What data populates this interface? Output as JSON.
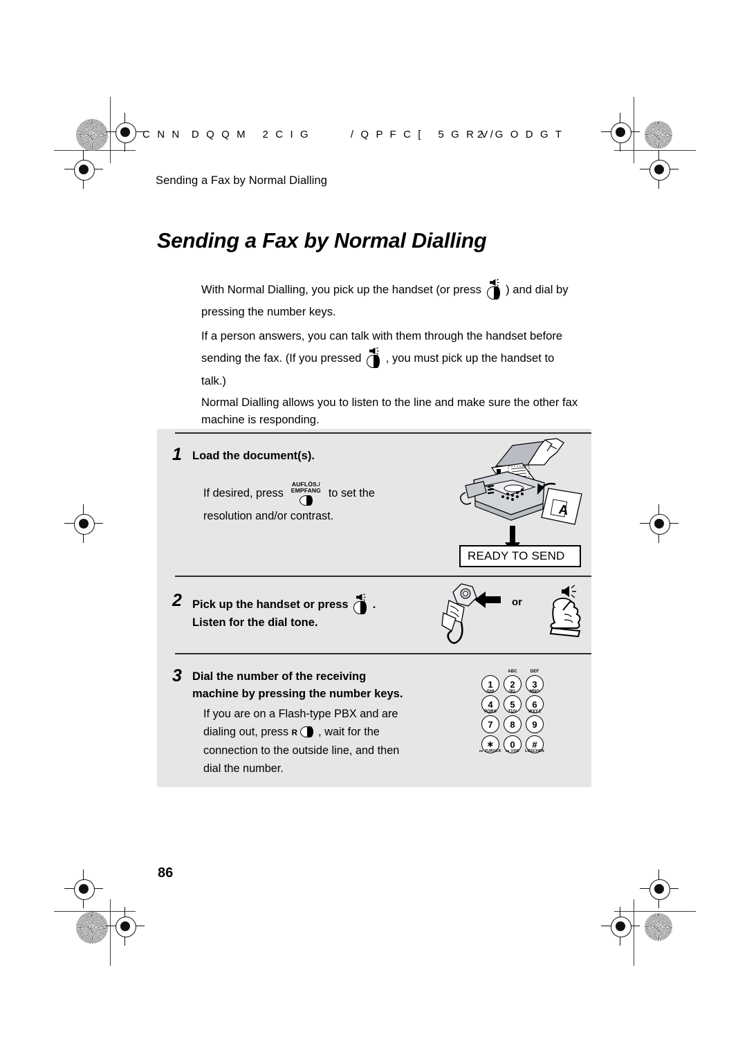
{
  "page": {
    "encoded_header": "C N N  D Q Q M   2 C I G        / Q P F C [   5 G R V G O D G T",
    "encoded_header_right": "2 /",
    "running_head": "Sending a Fax by Normal Dialling",
    "title": "Sending a Fax by Normal Dialling",
    "page_number": "86"
  },
  "intro": {
    "p1_a": "With Normal Dialling, you pick up the handset (or press",
    "p1_b": ") and dial by",
    "p1_c": "pressing the number keys.",
    "p2_a": "If a person answers, you can talk with them through the handset before",
    "p2_b": "sending the fax. (If you pressed",
    "p2_c": ", you must pick up the handset to",
    "p2_d": "talk.)",
    "p3_a": "Normal Dialling allows you to listen to the line and make sure the other fax",
    "p3_b": "machine is responding."
  },
  "steps": [
    {
      "number": "1",
      "heading": "Load the document(s).",
      "body_a": "If desired, press",
      "body_b": "to set the",
      "body_c": "resolution and/or contrast.",
      "key_label_line1": "AUFLÖS./",
      "key_label_line2": "EMPFANG",
      "display_text": "READY TO SEND"
    },
    {
      "number": "2",
      "heading_a": "Pick up the handset or press",
      "heading_b": ".",
      "heading_c": "Listen for the dial tone.",
      "or_label": "or"
    },
    {
      "number": "3",
      "heading_a": "Dial the number of the receiving",
      "heading_b": "machine by pressing the number keys.",
      "body_a": "If you are on a Flash-type PBX and are",
      "body_b": "dialing out, press",
      "body_c": ", wait for the",
      "body_d": "connection to the outside line, and then",
      "body_e": "dial the number.",
      "flash_key_label": "R"
    }
  ],
  "keypad": {
    "keys": [
      {
        "digit": "1",
        "letters": ""
      },
      {
        "digit": "2",
        "letters": "ABC"
      },
      {
        "digit": "3",
        "letters": "DEF"
      },
      {
        "digit": "4",
        "letters": "GHI"
      },
      {
        "digit": "5",
        "letters": "JKL"
      },
      {
        "digit": "6",
        "letters": "MNO"
      },
      {
        "digit": "7",
        "letters": "PQRS"
      },
      {
        "digit": "8",
        "letters": "TUV"
      },
      {
        "digit": "9",
        "letters": "WXYZ"
      },
      {
        "digit": "∗",
        "letters": "",
        "bottom": "ZURÜCK"
      },
      {
        "digit": "0",
        "letters": "",
        "bottom": "VOR"
      },
      {
        "digit": "#",
        "letters": "",
        "bottom": "LÖSCHEN"
      }
    ]
  },
  "colors": {
    "panel_bg": "#e6e6e6",
    "text": "#000000",
    "illustration_gray": "#b9bcc2"
  }
}
